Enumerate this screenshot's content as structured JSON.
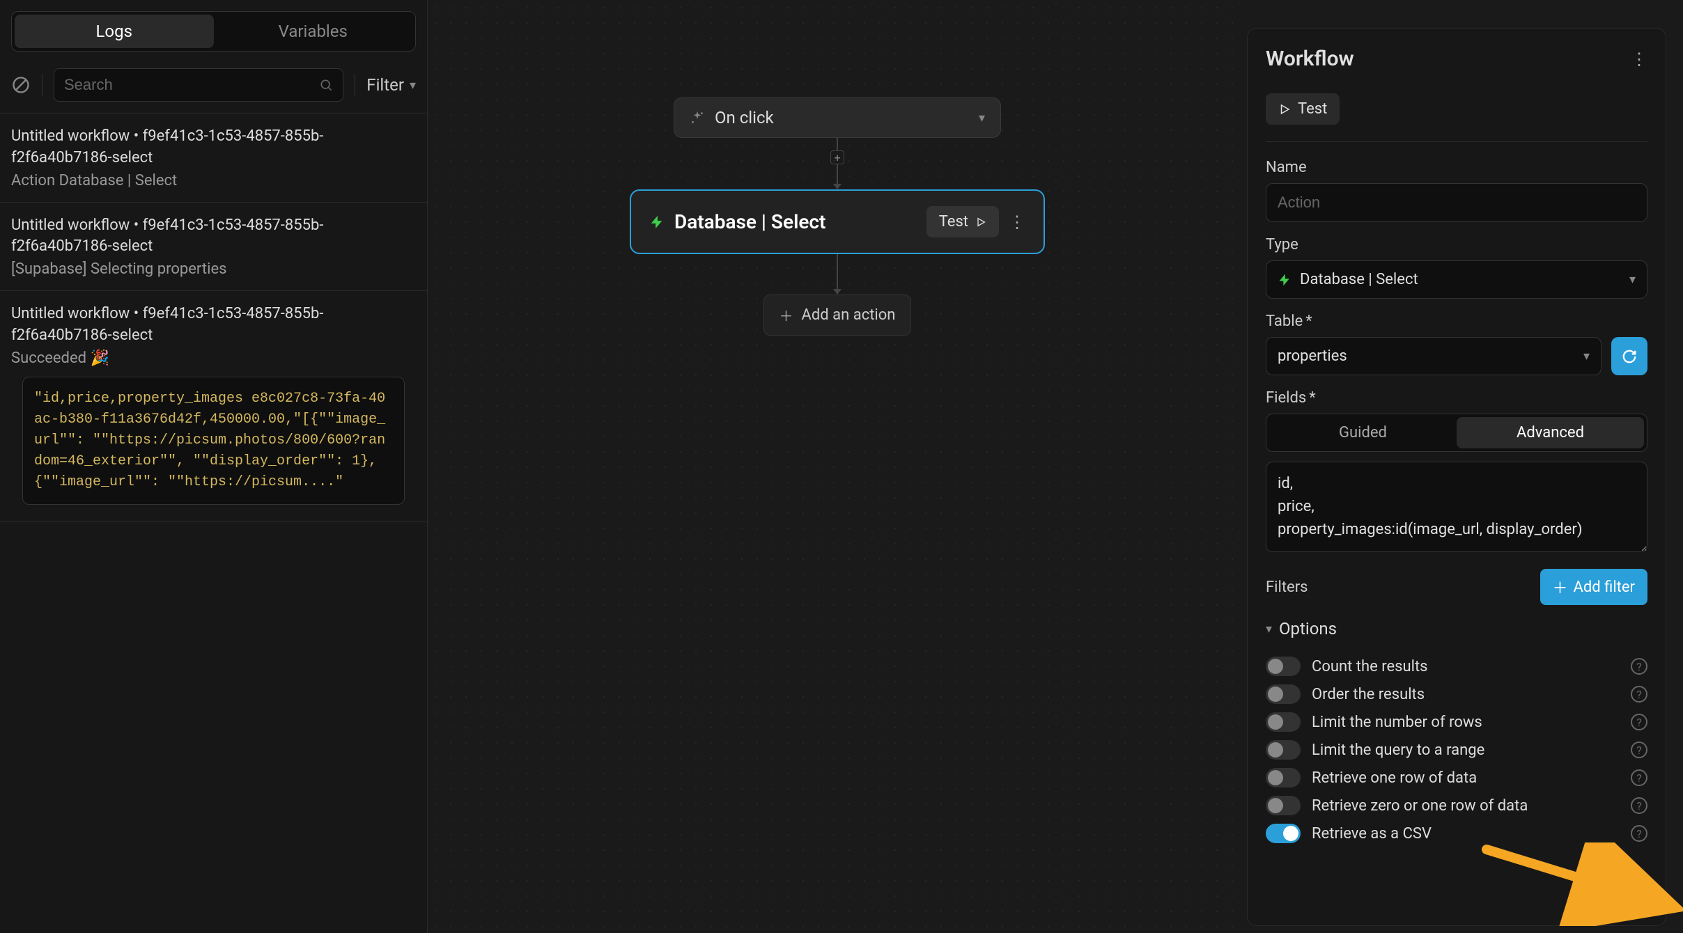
{
  "colors": {
    "accent": "#2b9fd9",
    "code": "#d4b85f",
    "bolt": "#3ecf4c"
  },
  "sidebar": {
    "tabs": {
      "logs": "Logs",
      "variables": "Variables",
      "active": "logs"
    },
    "search": {
      "placeholder": "Search"
    },
    "filter": {
      "label": "Filter"
    },
    "logs": [
      {
        "title": "Untitled workflow • f9ef41c3-1c53-4857-855b-f2f6a40b7186-select",
        "sub": "Action Database | Select"
      },
      {
        "title": "Untitled workflow • f9ef41c3-1c53-4857-855b-f2f6a40b7186-select",
        "sub": "[Supabase] Selecting properties"
      },
      {
        "title": "Untitled workflow • f9ef41c3-1c53-4857-855b-f2f6a40b7186-select",
        "sub": "Succeeded 🎉",
        "code": "\"id,price,property_images e8c027c8-73fa-40ac-b380-f11a3676d42f,450000.00,\"[{\"\"image_url\"\": \"\"https://picsum.photos/800/600?random=46_exterior\"\", \"\"display_order\"\": 1}, {\"\"image_url\"\": \"\"https://picsum....\""
      }
    ]
  },
  "canvas": {
    "trigger": {
      "label": "On click"
    },
    "node": {
      "title": "Database | Select",
      "test": "Test"
    },
    "add_action": "Add an action"
  },
  "panel": {
    "title": "Workflow",
    "test": "Test",
    "name": {
      "label": "Name",
      "placeholder": "Action",
      "value": ""
    },
    "type": {
      "label": "Type",
      "value": "Database | Select"
    },
    "table": {
      "label": "Table",
      "value": "properties"
    },
    "fields": {
      "label": "Fields",
      "seg": {
        "guided": "Guided",
        "advanced": "Advanced",
        "active": "advanced"
      },
      "value": "id,\nprice,\nproperty_images:id(image_url, display_order)"
    },
    "filters": {
      "label": "Filters",
      "add": "Add filter"
    },
    "options": {
      "label": "Options",
      "items": [
        {
          "label": "Count the results",
          "on": false
        },
        {
          "label": "Order the results",
          "on": false
        },
        {
          "label": "Limit the number of rows",
          "on": false
        },
        {
          "label": "Limit the query to a range",
          "on": false
        },
        {
          "label": "Retrieve one row of data",
          "on": false
        },
        {
          "label": "Retrieve zero or one row of data",
          "on": false
        },
        {
          "label": "Retrieve as a CSV",
          "on": true
        }
      ]
    }
  }
}
